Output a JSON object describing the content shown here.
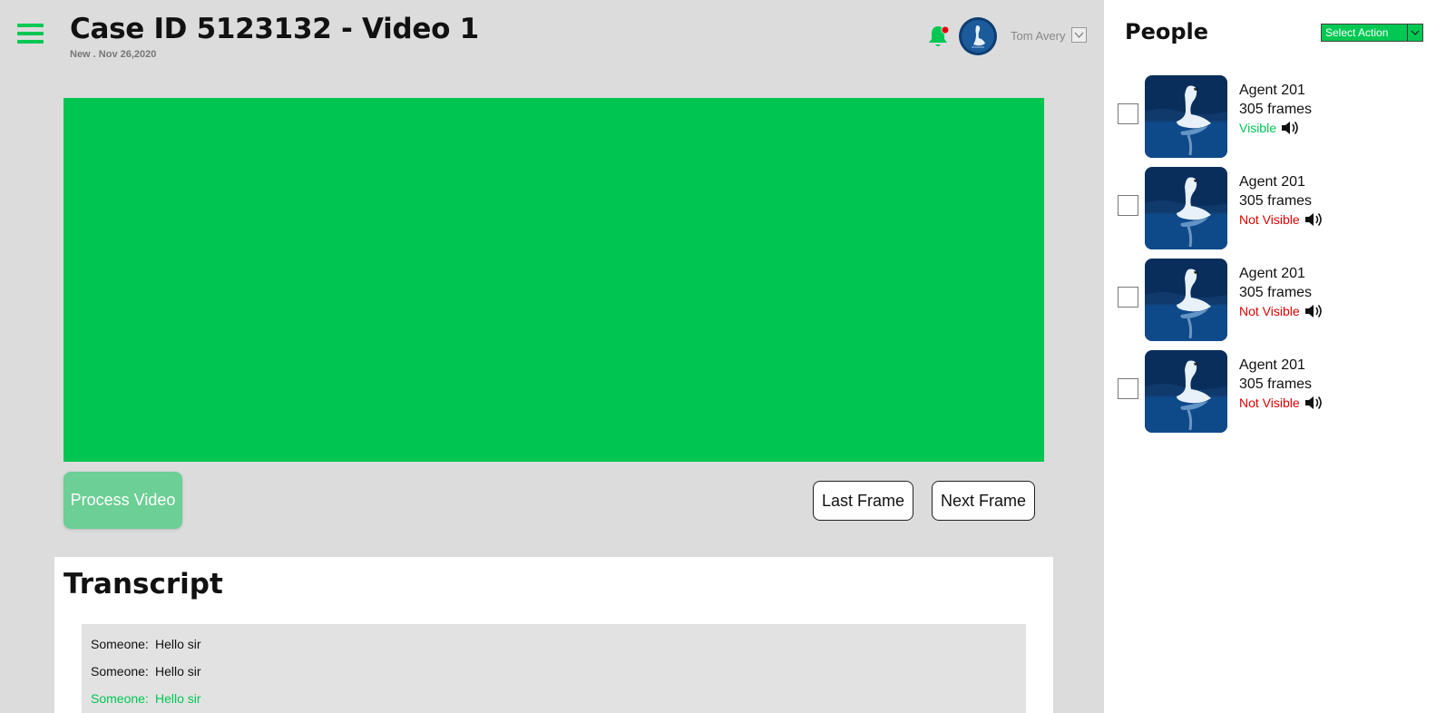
{
  "header": {
    "title": "Case ID 5123132 - Video 1",
    "subtitle": "New . Nov 26,2020",
    "username": "Tom Avery"
  },
  "controls": {
    "process_label": "Process Video",
    "last_frame_label": "Last Frame",
    "next_frame_label": "Next Frame"
  },
  "transcript": {
    "title": "Transcript",
    "lines": [
      {
        "speaker": "Someone:",
        "text": "Hello sir",
        "active": false
      },
      {
        "speaker": "Someone:",
        "text": "Hello sir",
        "active": false
      },
      {
        "speaker": "Someone:",
        "text": "Hello sir",
        "active": true
      }
    ]
  },
  "people": {
    "title": "People",
    "action_label": "Select Action",
    "items": [
      {
        "name": "Agent 201",
        "frames": "305 frames",
        "status": "Visible",
        "visible": true
      },
      {
        "name": "Agent 201",
        "frames": "305 frames",
        "status": "Not Visible",
        "visible": false
      },
      {
        "name": "Agent 201",
        "frames": "305 frames",
        "status": "Not Visible",
        "visible": false
      },
      {
        "name": "Agent 201",
        "frames": "305 frames",
        "status": "Not Visible",
        "visible": false
      }
    ]
  },
  "colors": {
    "accent": "#00c853",
    "video": "#00c551",
    "process_button": "#6ccf95",
    "not_visible": "#e00000",
    "background": "#dcdcdc"
  },
  "icons": {
    "menu": "hamburger-menu-icon",
    "notifications": "bell-icon",
    "user_dropdown": "chevron-down-icon",
    "audio": "speaker-icon",
    "person_thumbnail": "swan-thumbnail"
  }
}
